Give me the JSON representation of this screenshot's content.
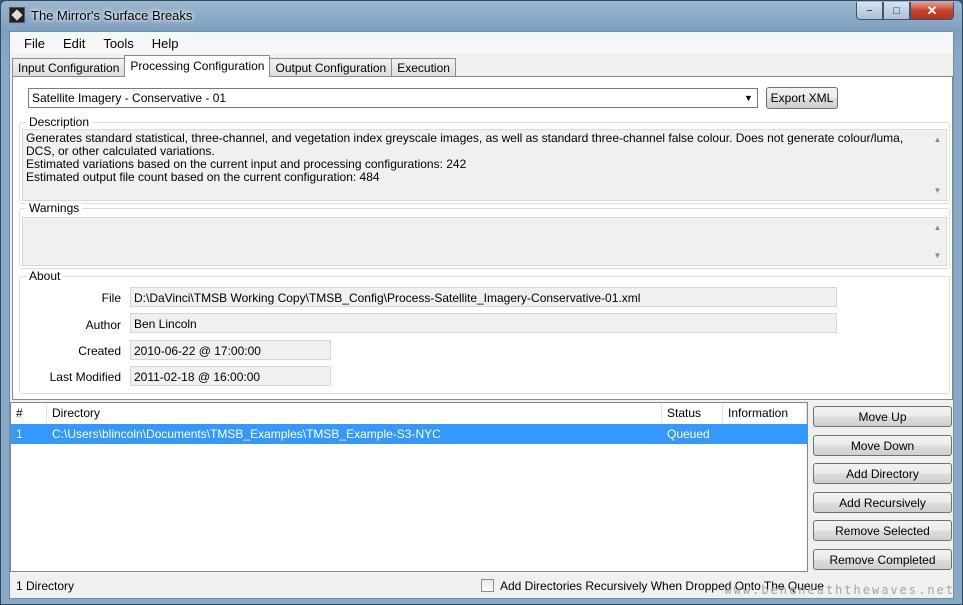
{
  "window": {
    "title": "The Mirror's Surface Breaks",
    "controls": {
      "minimize": "−",
      "maximize": "□",
      "close": "✕"
    }
  },
  "menu": [
    "File",
    "Edit",
    "Tools",
    "Help"
  ],
  "tabs": [
    "Input Configuration",
    "Processing Configuration",
    "Output Configuration",
    "Execution"
  ],
  "active_tab": "Processing Configuration",
  "config": {
    "selected": "Satellite Imagery - Conservative - 01",
    "export_label": "Export XML"
  },
  "description": {
    "legend": "Description",
    "line1": "Generates standard statistical, three-channel, and vegetation index greyscale images, as well as standard three-channel false colour. Does not generate colour/luma, DCS, or other calculated variations.",
    "line2": "Estimated variations based on the current input and processing configurations: 242",
    "line3": "Estimated output file count based on the current configuration: 484"
  },
  "warnings": {
    "legend": "Warnings",
    "text": ""
  },
  "about": {
    "legend": "About",
    "file_label": "File",
    "file_value": "D:\\DaVinci\\TMSB Working Copy\\TMSB_Config\\Process-Satellite_Imagery-Conservative-01.xml",
    "author_label": "Author",
    "author_value": "Ben Lincoln",
    "created_label": "Created",
    "created_value": "2010-06-22 @ 17:00:00",
    "modified_label": "Last Modified",
    "modified_value": "2011-02-18 @ 16:00:00"
  },
  "queue": {
    "columns": [
      "#",
      "Directory",
      "Status",
      "Information"
    ],
    "rows": [
      {
        "num": "1",
        "directory": "C:\\Users\\blincoln\\Documents\\TMSB_Examples\\TMSB_Example-S3-NYC",
        "status": "Queued",
        "information": ""
      }
    ]
  },
  "buttons": {
    "move_up": "Move Up",
    "move_down": "Move Down",
    "add_directory": "Add Directory",
    "add_recursively": "Add Recursively",
    "remove_selected": "Remove Selected",
    "remove_completed": "Remove Completed"
  },
  "status": {
    "count": "1 Directory",
    "recursive_checkbox": "Add Directories Recursively When Dropped Onto The Queue",
    "recursive_checked": false
  },
  "watermark": "www.beneneaththewaves.net"
}
